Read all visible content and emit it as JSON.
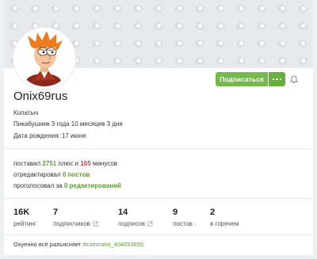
{
  "profile": {
    "username": "Onix69rus",
    "title": "Копатыч",
    "member_since": "Пикабушник 3 года 10 месяцев 3 дня",
    "birthday": "Дата рождения: 17 июня"
  },
  "actions": {
    "subscribe_label": "Подписаться",
    "more_icon": "more-dots-icon",
    "bell_icon": "bell-icon"
  },
  "votes": {
    "plus_prefix": "поставил ",
    "plus_count": "2751",
    "plus_middle": " плюс и ",
    "minus_count": "165",
    "minus_suffix": " минусов",
    "rejected_prefix": "отредактировал ",
    "rejected_count": "0 постов",
    "voted_prefix": "проголосовал за ",
    "voted_count": "0 редактирований"
  },
  "stats": [
    {
      "value": "16K",
      "label": "рейтинг",
      "link": false
    },
    {
      "value": "7",
      "label": "подписчиков",
      "link": true
    },
    {
      "value": "14",
      "label": "подписок",
      "link": true
    },
    {
      "value": "9",
      "label": "постов",
      "link": false
    },
    {
      "value": "2",
      "label": "в горячем",
      "link": false
    }
  ],
  "note": {
    "text": "Охуенно всё разъясняет ",
    "link": "#comment_404053855"
  },
  "colors": {
    "accent_green": "#75b84b",
    "minus_red": "#d23c3c",
    "link_green": "#5b9e31"
  }
}
